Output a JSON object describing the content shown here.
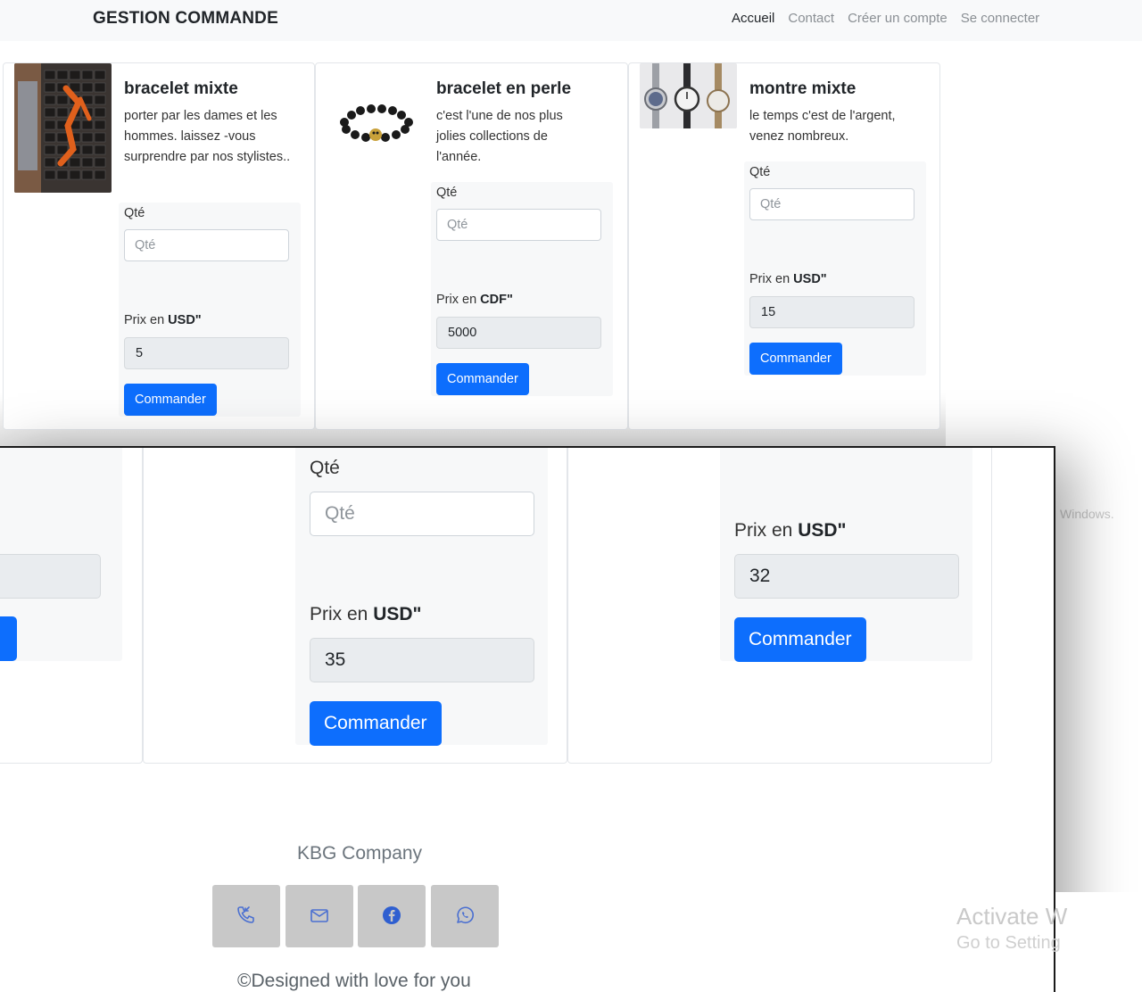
{
  "navbar": {
    "brand": "GESTION COMMANDE",
    "links": [
      "Accueil",
      "Contact",
      "Créer un compte",
      "Se connecter"
    ]
  },
  "products": [
    {
      "title": "bracelet mixte",
      "description": "porter par les dames et les hommes. laissez -vous surprendre par nos stylistes..",
      "qty_label": "Qté",
      "qty_placeholder": "Qté",
      "price_label_prefix": "Prix en ",
      "currency": "USD\"",
      "price": "5",
      "button": "Commander"
    },
    {
      "title": "bracelet en perle",
      "description": "c'est l'une de nos plus jolies collections de l'année.",
      "qty_label": "Qté",
      "qty_placeholder": "Qté",
      "price_label_prefix": "Prix en ",
      "currency": "CDF\"",
      "price": "5000",
      "button": "Commander"
    },
    {
      "title": "montre mixte",
      "description": "le temps c'est de l'argent, venez nombreux.",
      "qty_label": "Qté",
      "qty_placeholder": "Qté",
      "price_label_prefix": "Prix en ",
      "currency": "USD\"",
      "price": "15",
      "button": "Commander"
    }
  ],
  "zoom": {
    "middle": {
      "qty_label": "Qté",
      "qty_placeholder": "Qté",
      "price_label_prefix": "Prix en ",
      "currency": "USD\"",
      "price": "35",
      "button": "Commander"
    },
    "right": {
      "price_label_prefix": "Prix en ",
      "currency": "USD\"",
      "price": "32",
      "button": "Commander"
    }
  },
  "footer": {
    "company": "KBG Company",
    "social_icons": [
      "phone-icon",
      "mail-icon",
      "facebook-icon",
      "whatsapp-icon"
    ],
    "credit": "©Designed with love for you"
  },
  "watermark": {
    "line1": "Activate W",
    "line2": "Go to Setting",
    "fragment": "Windows."
  },
  "colors": {
    "primary": "#0d6efd",
    "navbar_bg": "#f8f9fa",
    "readonly_bg": "#e9ecef",
    "social_bg": "#c8c8c8"
  }
}
